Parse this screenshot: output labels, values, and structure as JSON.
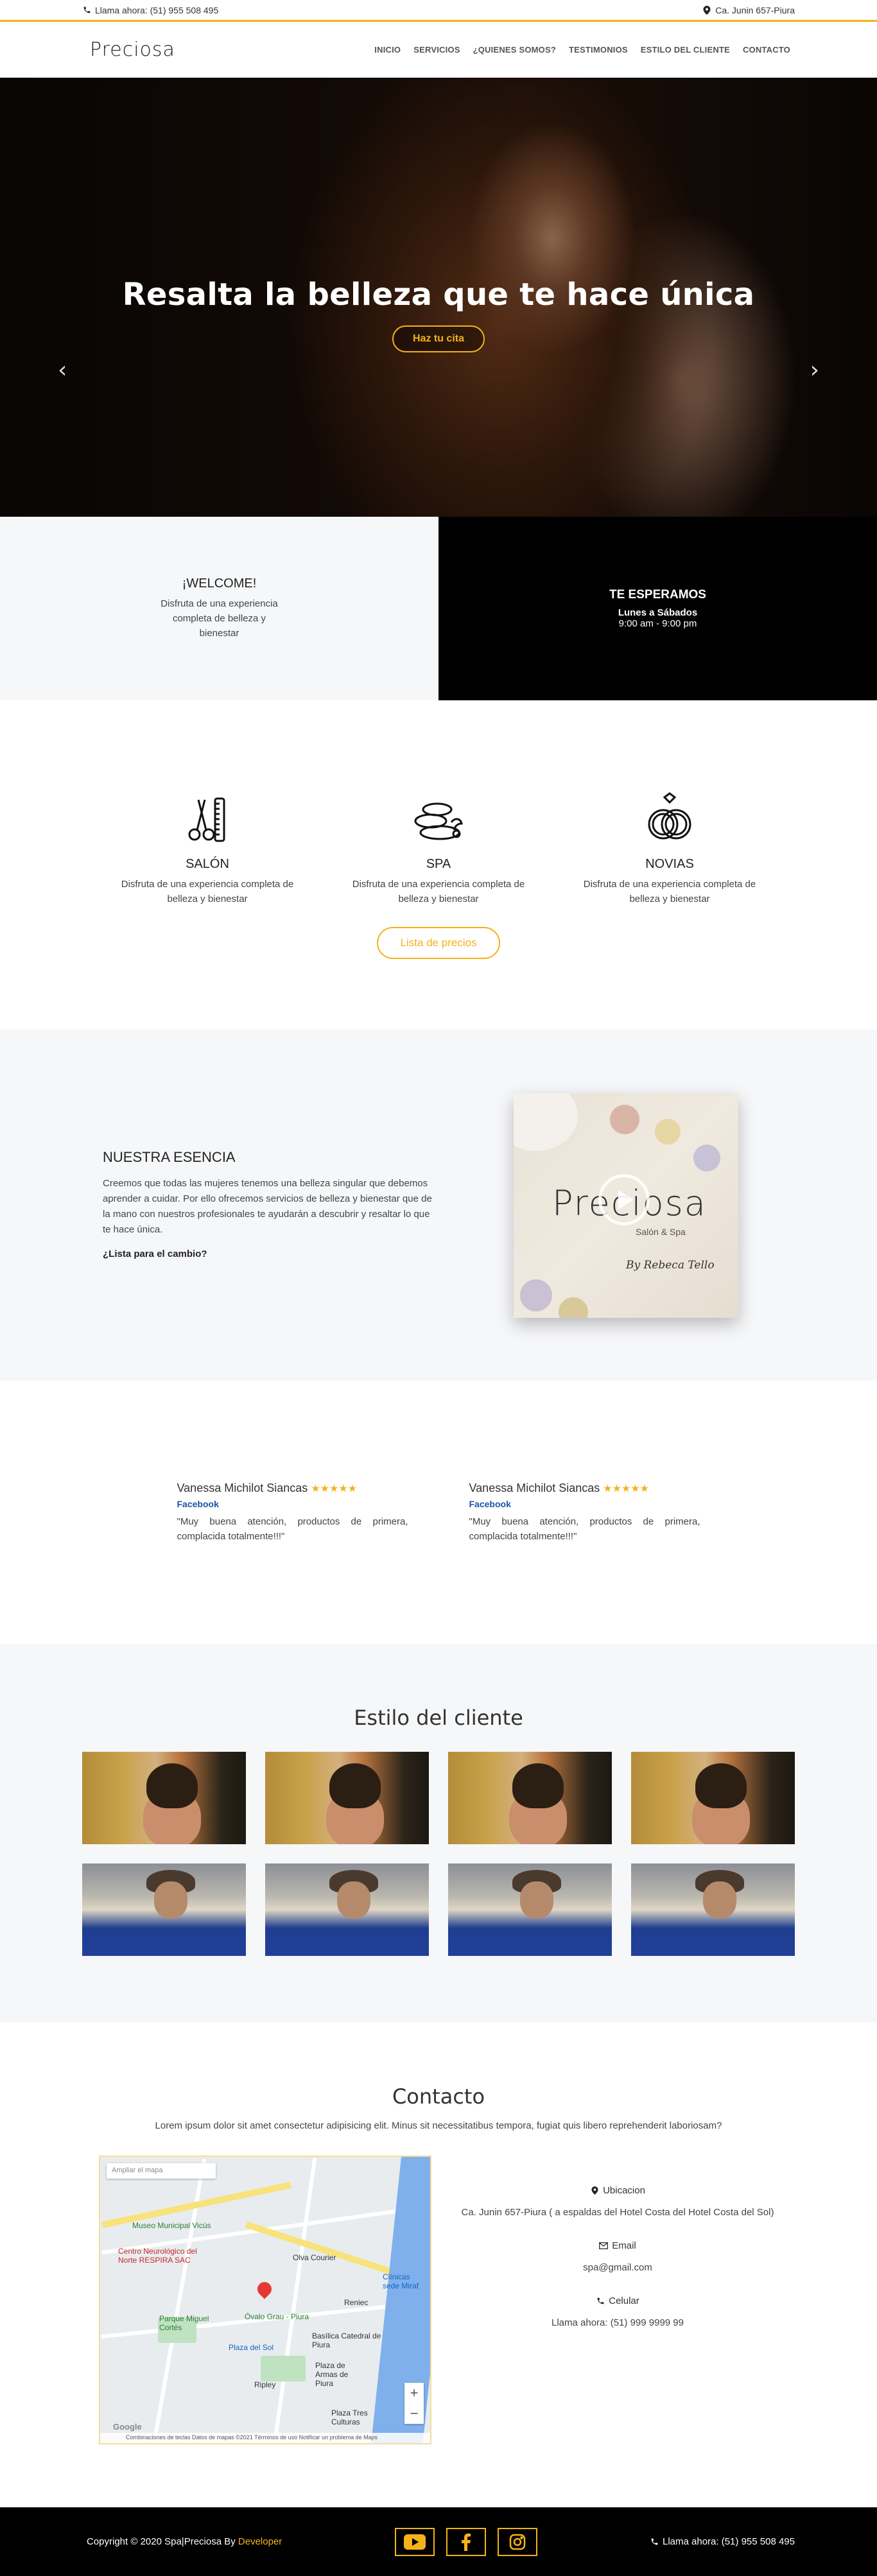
{
  "topbar": {
    "phone": "Llama ahora: (51) 955 508 495",
    "address": "Ca. Junin 657-Piura"
  },
  "nav": {
    "logo": "Preciosa",
    "items": [
      "INICIO",
      "SERVICIOS",
      "¿QUIENES SOMOS?",
      "TESTIMONIOS",
      "ESTILO DEL CLIENTE",
      "CONTACTO"
    ]
  },
  "hero": {
    "title": "Resalta la belleza que te hace única",
    "button": "Haz tu cita",
    "prev": "‹",
    "next": "›",
    "slides": 3,
    "active_slide": 1
  },
  "welcome": {
    "left_title": "¡WELCOME!",
    "left_text": "Disfruta de una experiencia completa de belleza y bienestar",
    "right_title": "TE ESPERAMOS",
    "right_days": "Lunes a Sábados",
    "right_hours": "9:00 am - 9:00 pm"
  },
  "services": {
    "items": [
      {
        "title": "SALÓN",
        "text": "Disfruta de una experiencia completa de belleza y bienestar",
        "icon": "scissors-comb-icon"
      },
      {
        "title": "SPA",
        "text": "Disfruta de una experiencia completa de belleza y bienestar",
        "icon": "spa-stones-icon"
      },
      {
        "title": "NOVIAS",
        "text": "Disfruta de una experiencia completa de belleza y bienestar",
        "icon": "wedding-rings-icon"
      }
    ],
    "button": "Lista de precios"
  },
  "essence": {
    "title": "NUESTRA ESENCIA",
    "text": "Creemos que todas las mujeres tenemos una belleza singular que debemos aprender a cuidar. Por ello ofrecemos servicios de belleza y bienestar que de la mano con nuestros profesionales te ayudarán a descubrir y resaltar lo que te hace única.",
    "question": "¿Lista para el cambio?",
    "video_brand": "Preciosa",
    "video_sub": "Salón & Spa",
    "video_signature": "By Rebeca Tello"
  },
  "testimonials": [
    {
      "name": "Vanessa Michilot Siancas",
      "stars": "★★★★★",
      "source": "Facebook",
      "text": "\"Muy buena atención, productos de primera, complacida totalmente!!!\""
    },
    {
      "name": "Vanessa Michilot Siancas",
      "stars": "★★★★★",
      "source": "Facebook",
      "text": "\"Muy buena atención, productos de primera, complacida totalmente!!!\""
    }
  ],
  "clients": {
    "title": "Estilo del cliente"
  },
  "contact": {
    "title": "Contacto",
    "intro": "Lorem ipsum dolor sit amet consectetur adipisicing elit. Minus sit necessitatibus tempora, fugiat quis libero reprehenderit laboriosam?",
    "map": {
      "search": "Ampliar el mapa",
      "labels": {
        "museo": "Museo Municipal Vicús",
        "centro": "Centro Neurológico del Norte RESPIRA SAC",
        "olva": "Olva Courier",
        "clinicas": "Clínicas sede Miraf",
        "parque": "Parque Miguel Cortés",
        "reniec": "Reniec",
        "ovalo": "Óvalo Grau - Piura",
        "plaza_sol": "Plaza del Sol",
        "basilica": "Basílica Catedral de Piura",
        "plaza_armas": "Plaza de Armas de Piura",
        "ripley": "Ripley",
        "plaza_culturas": "Plaza Tres Culturas"
      },
      "google": "Google",
      "attribution": "Combinaciones de teclas   Datos de mapas ©2021   Términos de uso   Notificar un problema de Maps"
    },
    "location_label": "Ubicacion",
    "location_value": "Ca. Junin 657-Piura ( a espaldas del Hotel Costa del Hotel Costa del Sol)",
    "email_label": "Email",
    "email_value": "spa@gmail.com",
    "cell_label": "Celular",
    "cell_value": "Llama ahora: (51) 999 9999 99"
  },
  "footer": {
    "copyright": "Copyright © 2020 Spa|Preciosa By ",
    "developer": "Developer",
    "phone": "Llama ahora: (51) 955 508 495"
  },
  "colors": {
    "accent": "#f3b21a",
    "dark": "#000000",
    "light_bg": "#f6f7f9"
  }
}
